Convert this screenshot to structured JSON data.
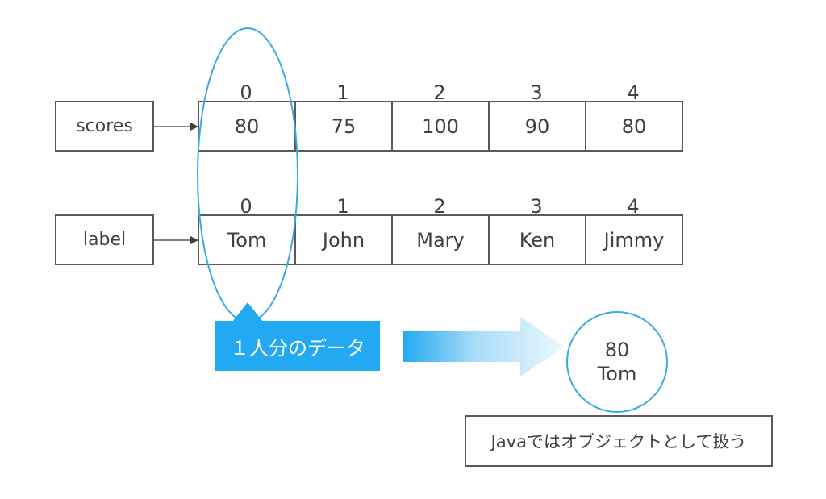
{
  "arrays": [
    {
      "name": "scores",
      "indices": [
        "0",
        "1",
        "2",
        "3",
        "4"
      ],
      "values": [
        "80",
        "75",
        "100",
        "90",
        "80"
      ]
    },
    {
      "name": "label",
      "indices": [
        "0",
        "1",
        "2",
        "3",
        "4"
      ],
      "values": [
        "Tom",
        "John",
        "Mary",
        "Ken",
        "Jimmy"
      ]
    }
  ],
  "callout": {
    "text": "１人分のデータ"
  },
  "result": {
    "line1": "80",
    "line2": "Tom"
  },
  "note": {
    "text": "Javaではオブジェクトとして扱う"
  },
  "colors": {
    "accent": "#22a9f1",
    "ellipse": "#3aa9e6",
    "border": "#595959",
    "text": "#404040"
  }
}
